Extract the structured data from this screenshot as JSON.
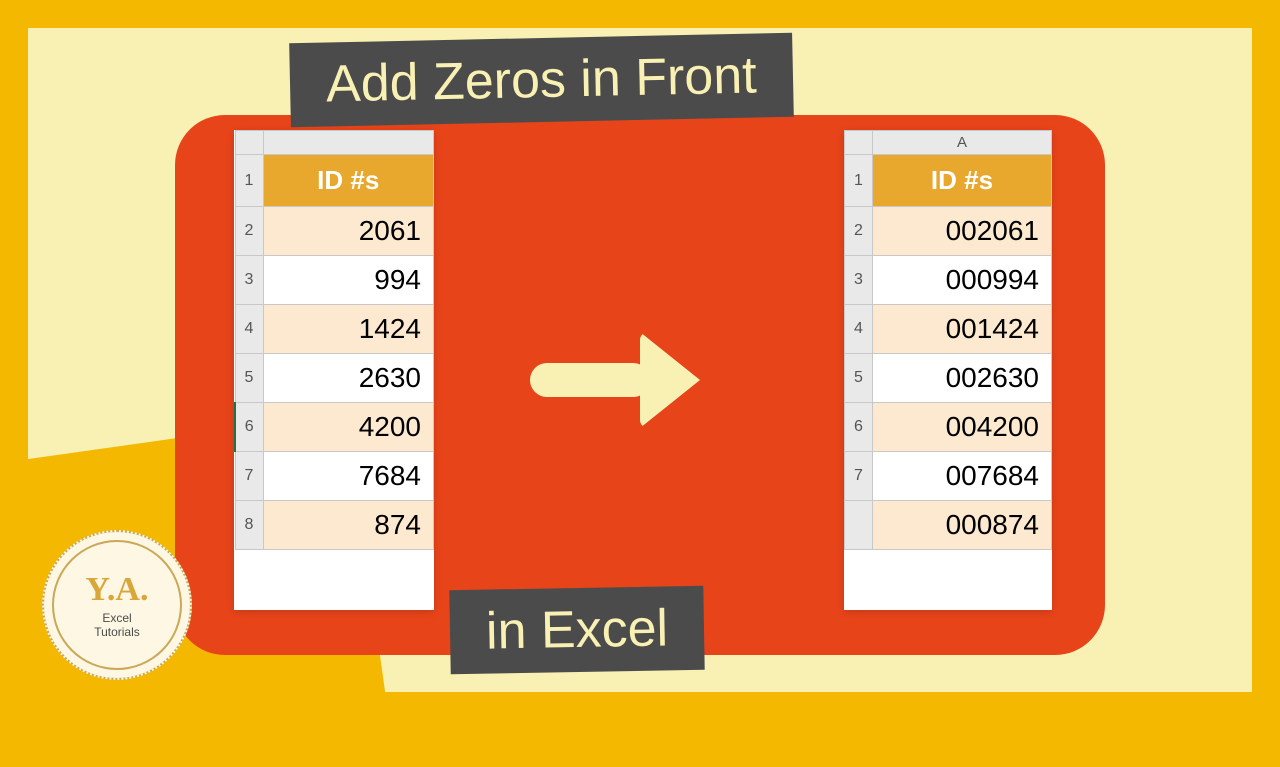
{
  "title_top": "Add Zeros in Front",
  "title_bottom": "in Excel",
  "col_label": "A",
  "left_table": {
    "header": "ID #s",
    "rows": [
      {
        "n": "1",
        "v": ""
      },
      {
        "n": "2",
        "v": "2061"
      },
      {
        "n": "3",
        "v": "994"
      },
      {
        "n": "4",
        "v": "1424"
      },
      {
        "n": "5",
        "v": "2630"
      },
      {
        "n": "6",
        "v": "4200"
      },
      {
        "n": "7",
        "v": "7684"
      },
      {
        "n": "8",
        "v": "874"
      }
    ]
  },
  "right_table": {
    "header": "ID #s",
    "rows": [
      {
        "n": "1",
        "v": ""
      },
      {
        "n": "2",
        "v": "002061"
      },
      {
        "n": "3",
        "v": "000994"
      },
      {
        "n": "4",
        "v": "001424"
      },
      {
        "n": "5",
        "v": "002630"
      },
      {
        "n": "6",
        "v": "004200"
      },
      {
        "n": "7",
        "v": "007684"
      },
      {
        "n": "",
        "v": "000874"
      }
    ]
  },
  "logo": {
    "initials": "Y.A.",
    "line1": "Excel",
    "line2": "Tutorials"
  }
}
